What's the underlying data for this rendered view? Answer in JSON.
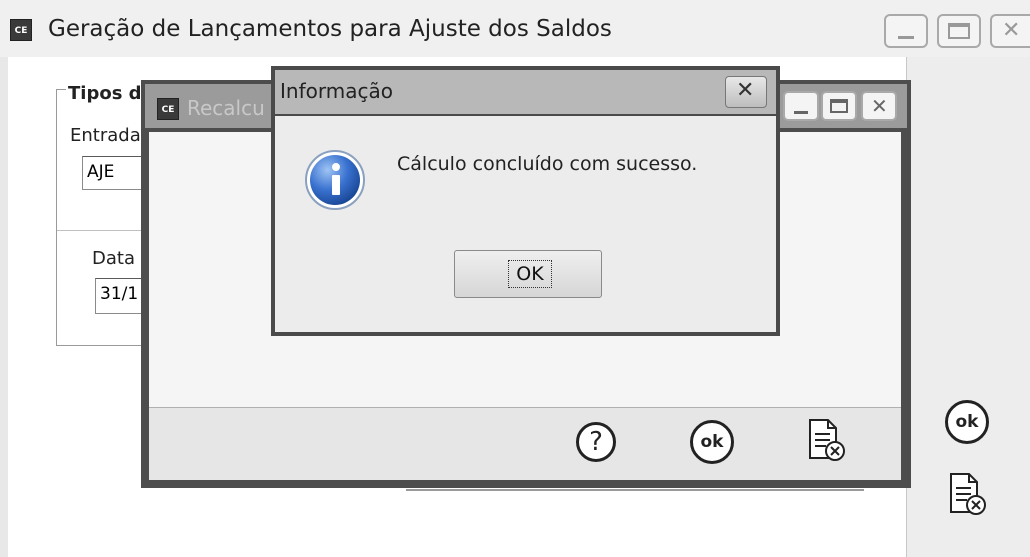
{
  "main_window": {
    "app_icon": "CE",
    "title": "Geração de Lançamentos para Ajuste dos Saldos",
    "group_title": "Tipos de",
    "entrada_label": "Entrada",
    "entrada_value": "AJE",
    "data_label": "Data",
    "data_value": "31/1",
    "side_ok_label": "ok"
  },
  "recalc_window": {
    "app_icon": "CE",
    "title": "Recalcu",
    "help_label": "?",
    "ok_label": "ok"
  },
  "info_dialog": {
    "title": "Informação",
    "message": "Cálculo concluído com sucesso.",
    "ok_button": "OK"
  },
  "icons": [
    "ce-app-icon",
    "info-icon",
    "help-icon",
    "ok-icon",
    "cancel-document-icon",
    "close-icon",
    "minimize-icon",
    "maximize-icon"
  ]
}
